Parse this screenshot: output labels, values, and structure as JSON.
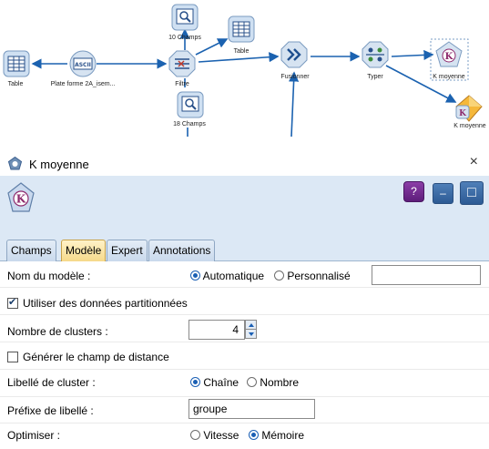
{
  "canvas": {
    "nodes": {
      "table_left": {
        "label": "Table",
        "icon": "table-icon"
      },
      "flatfile": {
        "label": "Plate forme  2A_isem...",
        "icon": "flat-file-icon"
      },
      "filter": {
        "label": "Filtre",
        "icon": "filter-icon"
      },
      "ten_fields": {
        "label": "10 Champs",
        "icon": "data-audit-icon"
      },
      "eighteen_fields": {
        "label": "18 Champs",
        "icon": "data-audit-icon"
      },
      "table_mid": {
        "label": "Table",
        "icon": "table-icon"
      },
      "merge": {
        "label": "Fusionner",
        "icon": "merge-icon"
      },
      "type": {
        "label": "Typer",
        "icon": "type-icon"
      },
      "kmeans_node": {
        "label": "K moyenne",
        "icon": "kmeans-icon"
      },
      "kmeans_model": {
        "label": "K moyenne",
        "icon": "model-nugget-icon"
      }
    },
    "link_color": "#1b62b0"
  },
  "dialog": {
    "title": "K moyenne",
    "close_glyph": "×",
    "header_buttons": {
      "help": "?",
      "minimize": "–",
      "maximize": "□"
    },
    "tabs": [
      {
        "label": "Champs",
        "active": false
      },
      {
        "label": "Modèle",
        "active": true
      },
      {
        "label": "Expert",
        "active": false
      },
      {
        "label": "Annotations",
        "active": false
      }
    ],
    "form": {
      "model_name": {
        "label": "Nom du modèle :",
        "option_auto": "Automatique",
        "option_custom": "Personnalisé",
        "selected": "Automatique",
        "custom_value": ""
      },
      "use_partitions": {
        "label": "Utiliser des données partitionnées",
        "checked": true
      },
      "num_clusters": {
        "label": "Nombre de clusters :",
        "value": "4"
      },
      "distance_field": {
        "label": "Générer le champ de distance",
        "checked": false
      },
      "cluster_label": {
        "label": "Libellé de cluster :",
        "option_string": "Chaîne",
        "option_number": "Nombre",
        "selected": "Chaîne"
      },
      "label_prefix": {
        "label": "Préfixe de libellé :",
        "value": "groupe"
      },
      "optimize": {
        "label": "Optimiser :",
        "option_speed": "Vitesse",
        "option_memory": "Mémoire",
        "selected": "Mémoire"
      }
    }
  },
  "colors": {
    "header_band": "#dce8f5",
    "active_tab": "#f6d98a",
    "accent_blue": "#1a5fb4"
  }
}
